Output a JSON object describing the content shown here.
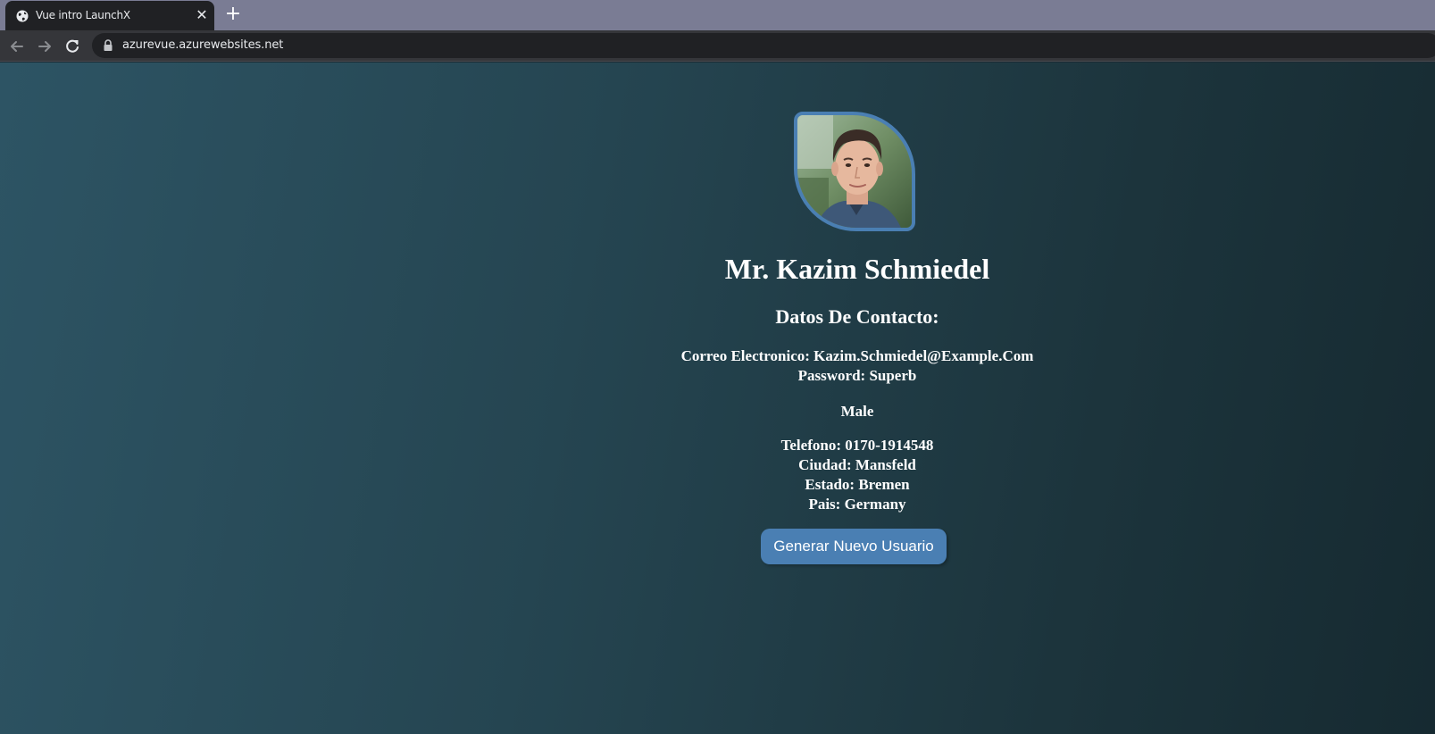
{
  "browser": {
    "tab": {
      "title": "Vue intro LaunchX",
      "favicon": "globe-icon",
      "close_icon": "close-icon"
    },
    "new_tab_icon": "plus-icon",
    "nav": {
      "back_icon": "arrow-left-icon",
      "forward_icon": "arrow-right-icon",
      "reload_icon": "reload-icon"
    },
    "address": {
      "url": "azurevue.azurewebsites.net",
      "icon": "lock-icon"
    }
  },
  "profile": {
    "avatar_alt": "profile-photo",
    "name": "Mr. Kazim Schmiedel",
    "contact_heading": "Datos De Contacto:",
    "email_line": "Correo Electronico: Kazim.Schmiedel@Example.Com",
    "password_line": "Password: Superb",
    "gender": "Male",
    "phone_line": "Telefono: 0170-1914548",
    "city_line": "Ciudad: Mansfeld",
    "state_line": "Estado: Bremen",
    "country_line": "Pais: Germany",
    "button_label": "Generar Nuevo Usuario"
  },
  "colors": {
    "accent": "#4a7fb3",
    "text": "#ffffff",
    "bg_start": "#2d5464",
    "bg_end": "#162a31"
  }
}
